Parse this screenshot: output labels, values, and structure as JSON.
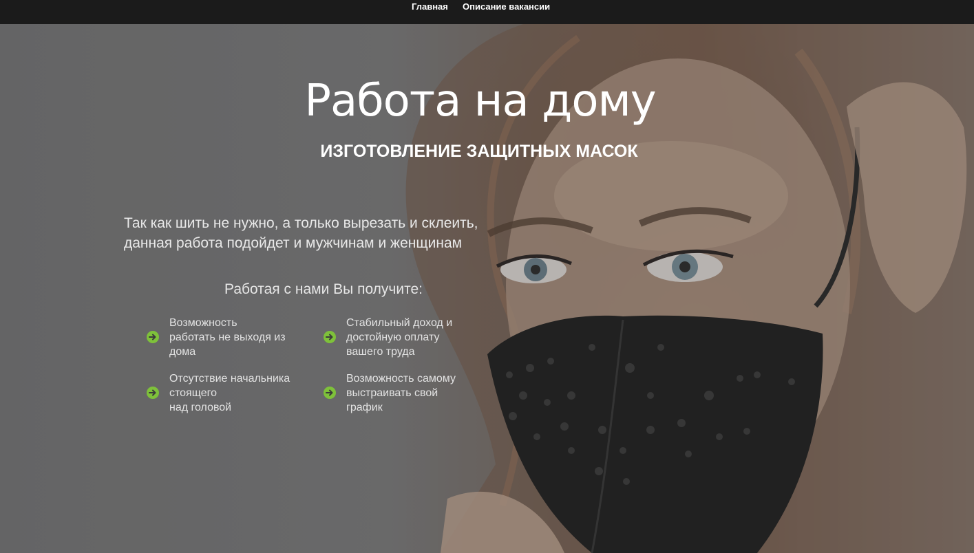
{
  "nav": {
    "items": [
      {
        "label": "Главная"
      },
      {
        "label": "Описание вакансии"
      }
    ]
  },
  "hero": {
    "title": "Работа на дому",
    "subtitle": "ИЗГОТОВЛЕНИЕ ЗАЩИТНЫХ МАСОК",
    "lead_lines": [
      "Так как шить не нужно, а только вырезать и склеить,",
      "данная работа подойдет и мужчинам и женщинам"
    ],
    "benefits_heading": "Работая с нами Вы получите:",
    "benefits": [
      {
        "icon": "arrow-right-circle-icon",
        "lines": [
          "Возможность",
          "работать не выходя из",
          "дома"
        ]
      },
      {
        "icon": "arrow-right-circle-icon",
        "lines": [
          "Стабильный доход и",
          "достойную оплату",
          "вашего труда"
        ]
      },
      {
        "icon": "arrow-right-circle-icon",
        "lines": [
          "Отсутствие начальника",
          "стоящего",
          "над головой"
        ]
      },
      {
        "icon": "arrow-right-circle-icon",
        "lines": [
          "Возможность самому",
          "выстраивать свой",
          "график"
        ]
      }
    ],
    "background_image": "photo-woman-black-mask"
  },
  "colors": {
    "topbar": "#1b1b1b",
    "accent_green": "#7ec13a",
    "text_white": "#ffffff",
    "overlay_gray": "#6e6c6d"
  }
}
